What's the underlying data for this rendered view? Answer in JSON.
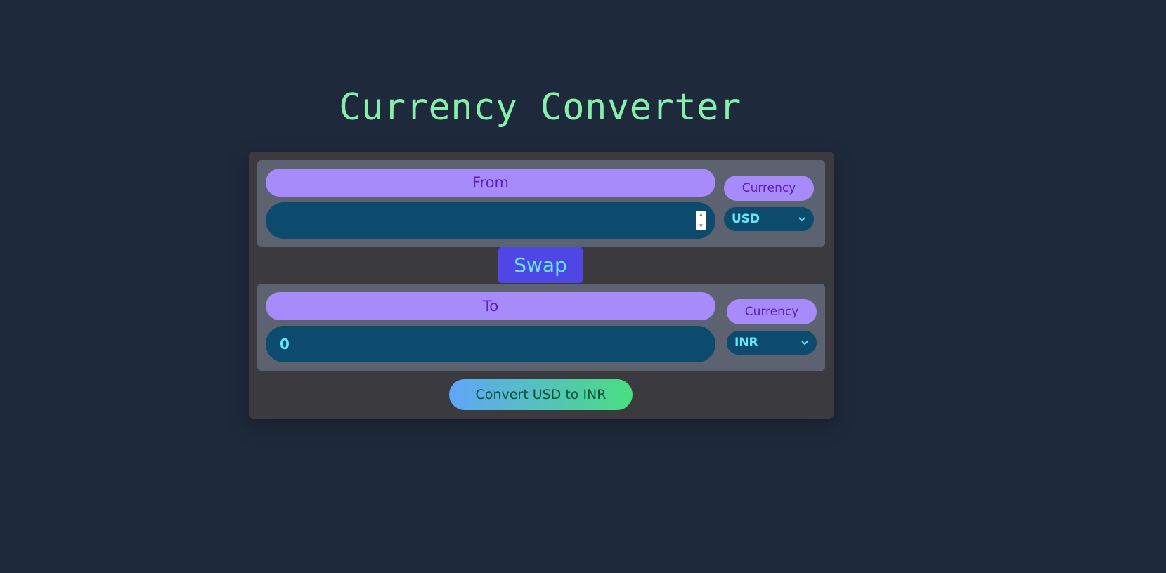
{
  "header": {
    "title": "Currency Converter"
  },
  "from": {
    "label": "From",
    "amount_value": "",
    "currency_label": "Currency",
    "currency_selected": "USD"
  },
  "swap": {
    "label": "Swap"
  },
  "to": {
    "label": "To",
    "amount_value": "0",
    "currency_label": "Currency",
    "currency_selected": "INR"
  },
  "convert": {
    "label": "Convert USD to INR"
  },
  "icons": {
    "spinner_up": "spinner-up-icon",
    "spinner_down": "spinner-down-icon",
    "chevron": "chevron-down-icon"
  },
  "colors": {
    "background": "#1e293b",
    "title": "#86efac",
    "card": "#3a3a3f",
    "panel": "#5c6270",
    "pill": "#a78bfa",
    "pill_text": "#5b21b6",
    "input_bg": "#0c4a6e",
    "input_text": "#67e8f9",
    "swap_bg": "#4f46e5",
    "convert_gradient_start": "#60a5fa",
    "convert_gradient_end": "#4ade80"
  }
}
